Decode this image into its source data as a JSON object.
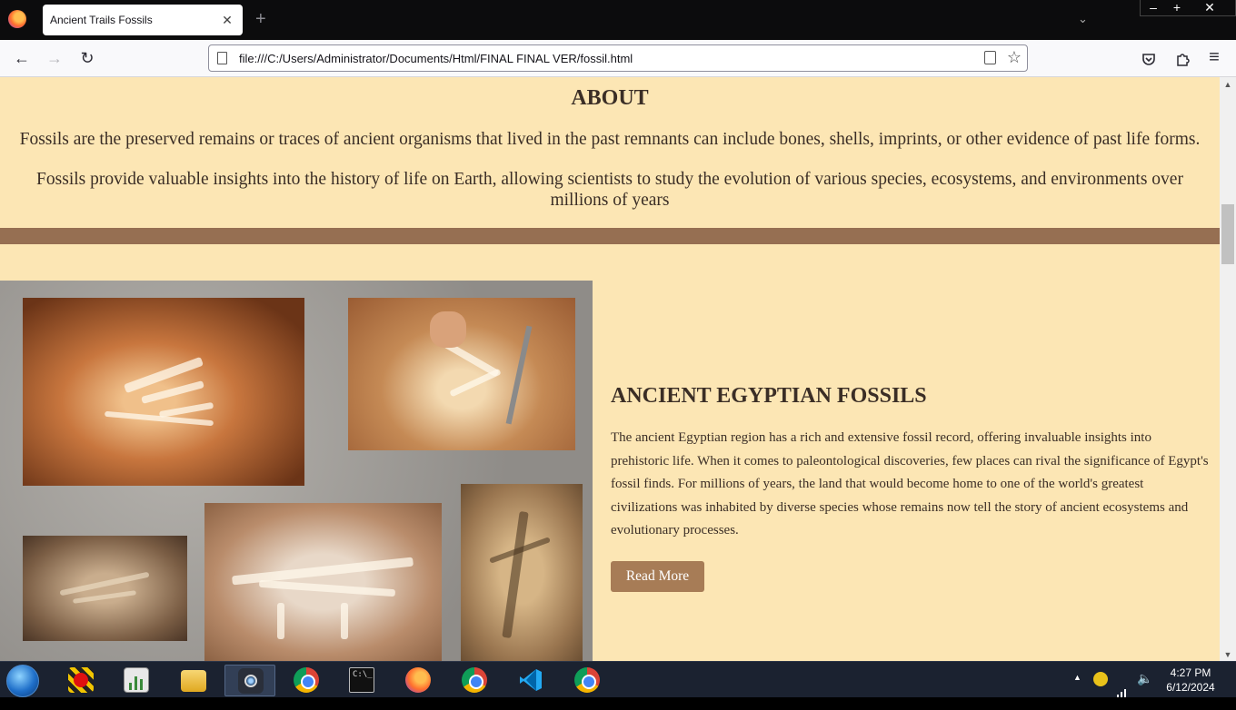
{
  "browser": {
    "tab_title": "Ancient Trails Fossils",
    "tab_close": "✕",
    "new_tab": "+",
    "url": "file:///C:/Users/Administrator/Documents/Html/FINAL FINAL VER/fossil.html",
    "back": "←",
    "forward": "→",
    "reload": "↻",
    "bookmark_star": "☆",
    "menu_icon": "≡",
    "window_minimize": "–",
    "window_maximize": "+",
    "window_close": "✕"
  },
  "about": {
    "heading": "ABOUT",
    "paragraph1": "Fossils are the preserved remains or traces of ancient organisms that lived in the past remnants can include bones, shells, imprints, or other evidence of past life forms.",
    "paragraph2": "Fossils provide valuable insights into the history of life on Earth, allowing scientists to study the evolution of various species, ecosystems, and environments over millions of years"
  },
  "egypt": {
    "heading": "ANCIENT EGYPTIAN FOSSILS",
    "body": "The ancient Egyptian region has a rich and extensive fossil record, offering invaluable insights into prehistoric life. When it comes to paleontological discoveries, few places can rival the significance of Egypt's fossil finds. For millions of years, the land that would become home to one of the world's greatest civilizations was inhabited by diverse species whose remains now tell the story of ancient ecosystems and evolutionary processes.",
    "button_label": "Read More"
  },
  "taskbar": {
    "items": [
      "recorder",
      "task-manager",
      "file-explorer",
      "camera",
      "chrome",
      "command-prompt",
      "firefox",
      "chrome-profile",
      "vscode",
      "chrome"
    ],
    "clock_time": "4:27 PM",
    "clock_date": "6/12/2024"
  },
  "colors": {
    "page_bg": "#fce6b4",
    "divider": "#966f52",
    "button_bg": "#a77c56",
    "heading_text": "#3b2e26"
  }
}
